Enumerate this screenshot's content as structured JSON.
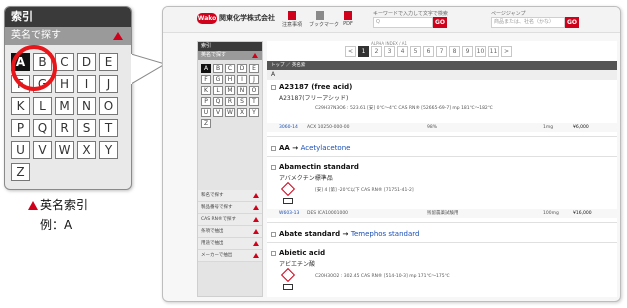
{
  "zoom": {
    "header": "索引",
    "subheader": "英名で探す",
    "keys": [
      "A",
      "B",
      "C",
      "D",
      "E",
      "F",
      "G",
      "H",
      "I",
      "J",
      "K",
      "L",
      "M",
      "N",
      "O",
      "P",
      "Q",
      "R",
      "S",
      "T",
      "U",
      "V",
      "W",
      "X",
      "Y",
      "Z"
    ],
    "active_key": "A"
  },
  "caption": {
    "line1": "英名索引",
    "line2": "例：A"
  },
  "topbar": {
    "logo_badge": "Wako",
    "logo_name": "関東化学株式会社",
    "icons": [
      {
        "label": "注意事項",
        "icon": "doc-icon"
      },
      {
        "label": "ブックマーク",
        "icon": "bookmark-icon"
      },
      {
        "label": "PDF",
        "icon": "pdf-icon"
      }
    ],
    "search1_caption": "キーワードで入力して文字で検索",
    "search1_placeholder": "Q",
    "search2_caption": "ページジャンプ",
    "search2_placeholder": "商品または、社名（かな）",
    "go_label": "GO"
  },
  "side": {
    "header": "索引",
    "subheader": "英名で探す",
    "keys": [
      "A",
      "B",
      "C",
      "D",
      "E",
      "F",
      "G",
      "H",
      "I",
      "J",
      "K",
      "L",
      "M",
      "N",
      "O",
      "P",
      "Q",
      "R",
      "S",
      "T",
      "U",
      "V",
      "W",
      "X",
      "Y",
      "Z"
    ],
    "active_key": "A",
    "menu": [
      "和名で探す",
      "製品番号で探す",
      "CAS RN®で探す",
      "条項で抽出",
      "用途で抽出",
      "メーカーで抽出"
    ]
  },
  "main": {
    "pager_caption": "ALPHA INDEX / A1",
    "pages": [
      "<",
      "1",
      "2",
      "3",
      "4",
      "5",
      "6",
      "7",
      "8",
      "9",
      "10",
      "11",
      ">"
    ],
    "current_page": "1",
    "breadcrumb": "トップ ／ 英名索",
    "section": "A",
    "entries": [
      {
        "title": "A23187 (free acid)",
        "jp": "A23187(フリーアシッド)",
        "formula": "C29H37N3O6 : 523.61 [安] 0℃〜4℃  CAS RN® [52665-69-7]  mp 181℃〜182℃",
        "code": "3060-14",
        "desc": "ACX 10250-000-00",
        "purity": "98%",
        "qty": "1mg",
        "price": "¥6,000"
      },
      {
        "title": "AA",
        "link": "Acetylacetone"
      },
      {
        "title": "Abamectin standard",
        "jp": "アバメクチン標準品",
        "formula": "[安] 4 [第] -20℃以下  CAS RN® [71751-41-2]",
        "code": "W603-13",
        "desc": "DES ICA10001000",
        "purity": "残留農薬試験用",
        "qty": "100mg",
        "price": "¥16,000"
      },
      {
        "title": "Abate standard",
        "link": "Temephos standard"
      },
      {
        "title": "Abietic acid",
        "jp": "アビエチン酸",
        "formula": "C20H30O2 : 302.45  CAS RN® [514-10-3]  mp 171℃〜175℃"
      }
    ]
  }
}
